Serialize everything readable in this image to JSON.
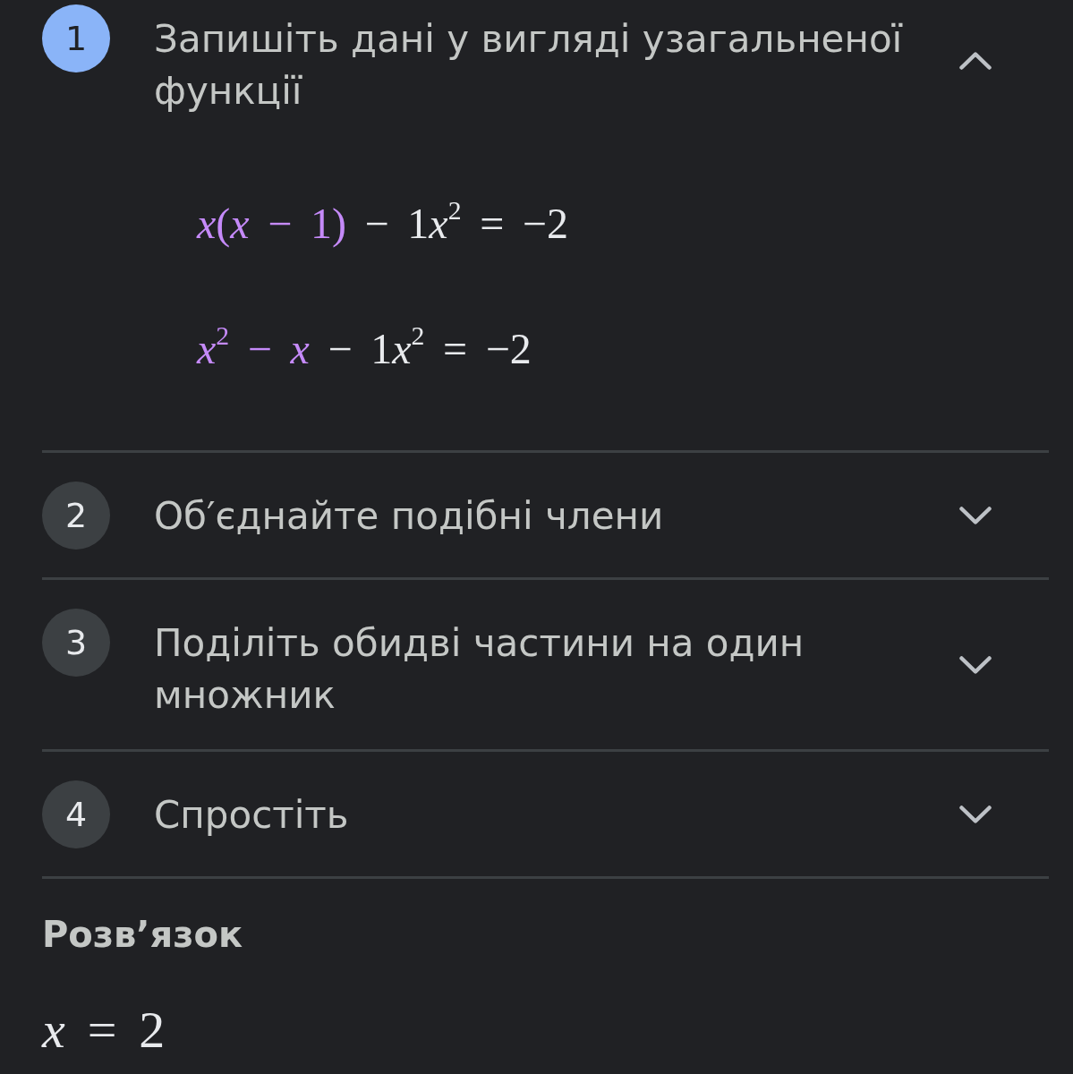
{
  "steps": [
    {
      "number": "1",
      "title": "Запишіть дані у вигляді узагальненої функції",
      "expanded": true,
      "equations": [
        {
          "segments": [
            {
              "text": "*x*(*x* − 1)",
              "highlighted": true
            },
            {
              "text": " − 1",
              "highlighted": false
            },
            {
              "text": "*x*$^{2}$ = −2",
              "highlighted": false
            }
          ]
        },
        {
          "segments": [
            {
              "text": "*x*$^{2}$ − *x*",
              "highlighted": true
            },
            {
              "text": " − 1",
              "highlighted": false
            },
            {
              "text": "*x*$^{2}$ = −2",
              "highlighted": false
            }
          ]
        }
      ]
    },
    {
      "number": "2",
      "title": "Об′єднайте подібні члени",
      "expanded": false
    },
    {
      "number": "3",
      "title": "Поділіть обидві частини на один множник",
      "expanded": false
    },
    {
      "number": "4",
      "title": "Спростіть",
      "expanded": false
    }
  ],
  "solution": {
    "heading": "Розв’язок",
    "answer": "*x* = 2"
  }
}
